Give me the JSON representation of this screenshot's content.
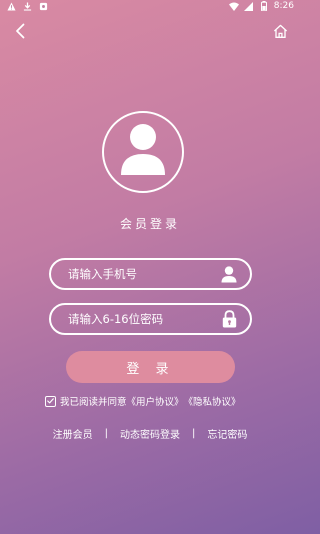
{
  "status_bar": {
    "time": "8:26"
  },
  "login": {
    "title": "会员登录",
    "phone_placeholder": "请输入手机号",
    "password_placeholder": "请输入6-16位密码",
    "submit_label": "登 录"
  },
  "agreement": {
    "checked": true,
    "prefix": "我已阅读并同意",
    "user_agreement": "《用户协议》",
    "privacy_agreement": "《隐私协议》"
  },
  "links": {
    "register": "注册会员",
    "sms_login": "动态密码登录",
    "forgot_password": "忘记密码",
    "separator": "|"
  },
  "icons": {
    "back": "chevron-left-icon",
    "home": "home-icon",
    "avatar": "user-avatar-icon",
    "phone_field": "user-icon",
    "password_field": "lock-icon",
    "checkbox": "check-icon"
  },
  "colors": {
    "accent_button": "#de8c9f",
    "gradient_start": "#d98aa3",
    "gradient_end": "#7f5fa4"
  }
}
